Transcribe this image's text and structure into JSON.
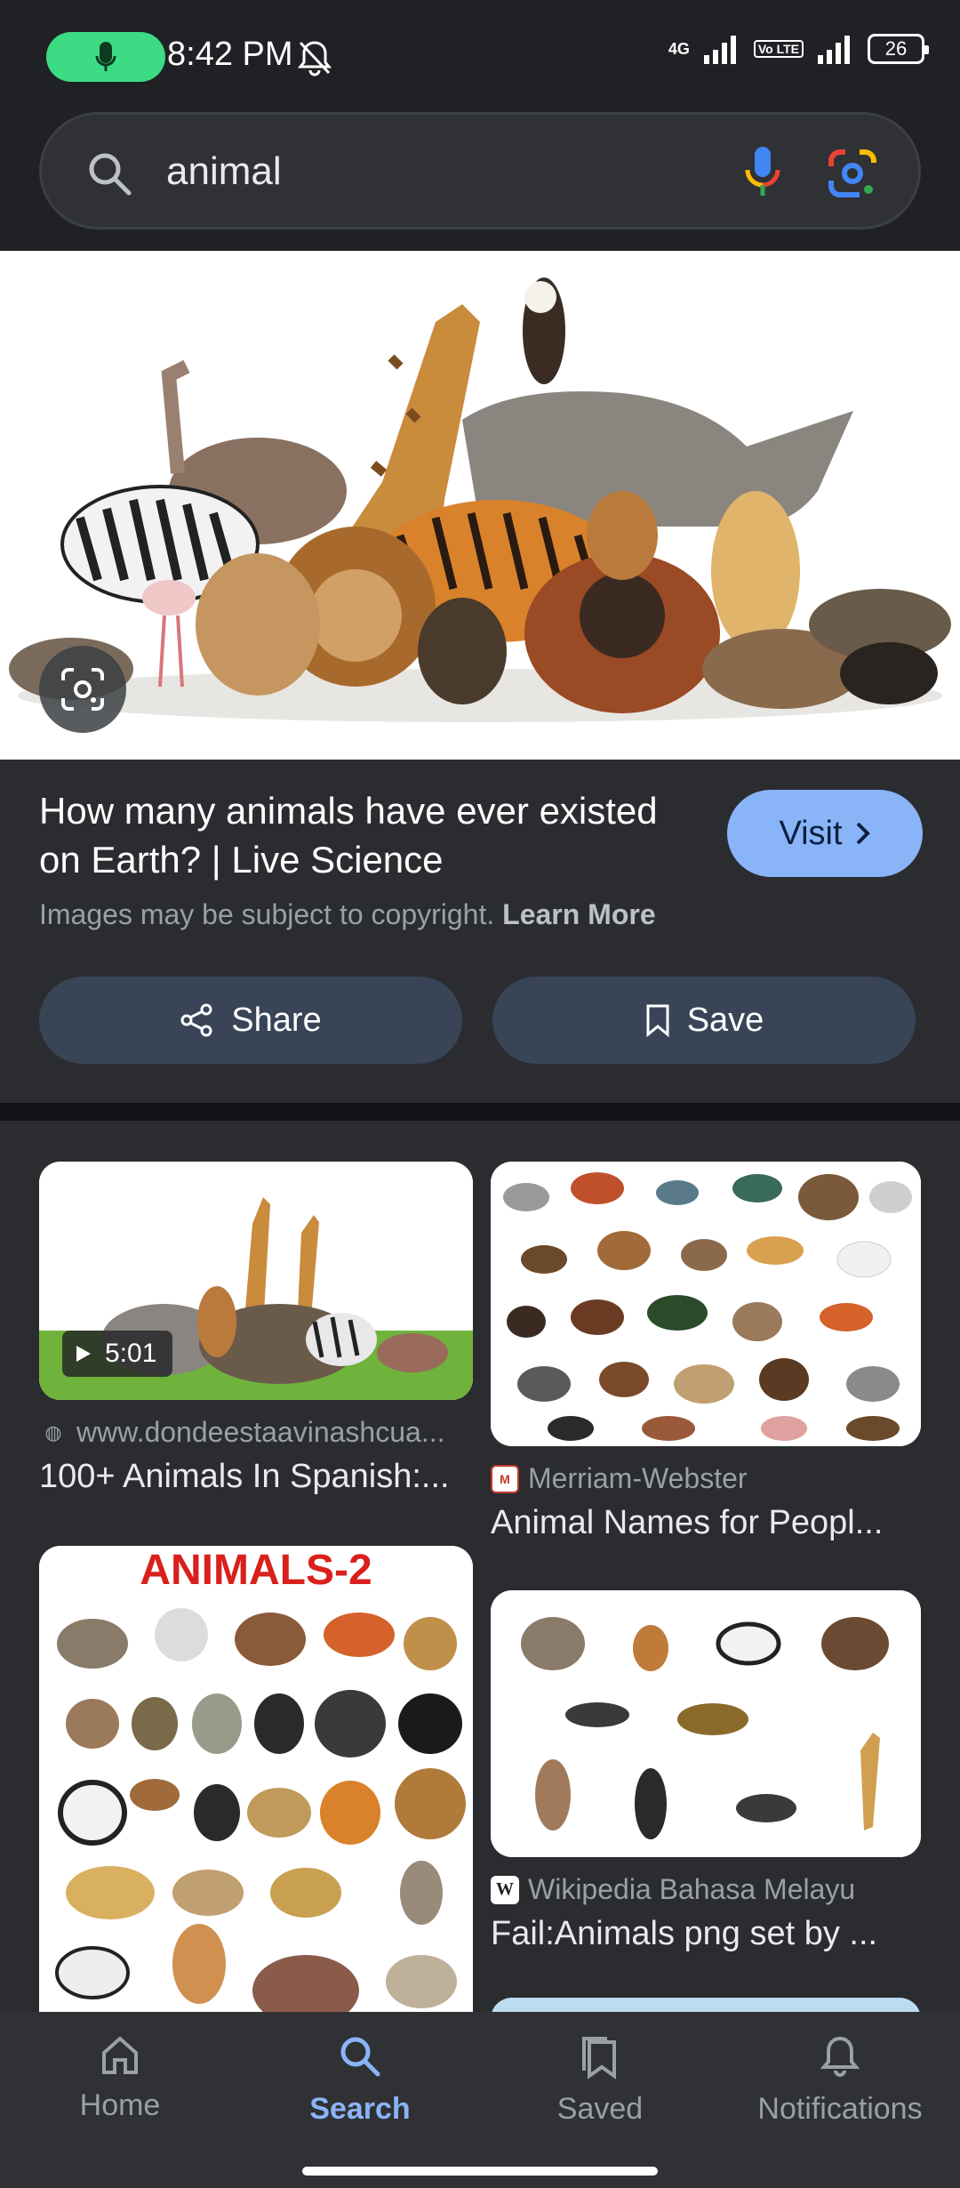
{
  "status_bar": {
    "time": "8:42 PM",
    "network": "4G",
    "volte": "Vo LTE",
    "battery": "26"
  },
  "search": {
    "query": "animal",
    "placeholder": ""
  },
  "result": {
    "title": "How many animals have ever existed on Earth? | Live Science",
    "visit_label": "Visit",
    "copyright_text": "Images may be subject to copyright.",
    "learn_more": "Learn More",
    "share_label": "Share",
    "save_label": "Save"
  },
  "related": [
    {
      "source": "www.dondeestaavinashcua...",
      "title": "100+ Animals In Spanish:...",
      "duration": "5:01"
    },
    {
      "source": "Merriam-Webster",
      "title": "Animal Names for Peopl..."
    },
    {
      "poster_title": "ANIMALS-2"
    },
    {
      "source": "Wikipedia Bahasa Melayu",
      "title": "Fail:Animals png set by ..."
    }
  ],
  "nav": {
    "home": "Home",
    "search": "Search",
    "saved": "Saved",
    "notifications": "Notifications"
  },
  "colors": {
    "accent": "#8ab4f8",
    "background": "#1f2125",
    "surface": "#2a2c30",
    "button": "#394457"
  }
}
